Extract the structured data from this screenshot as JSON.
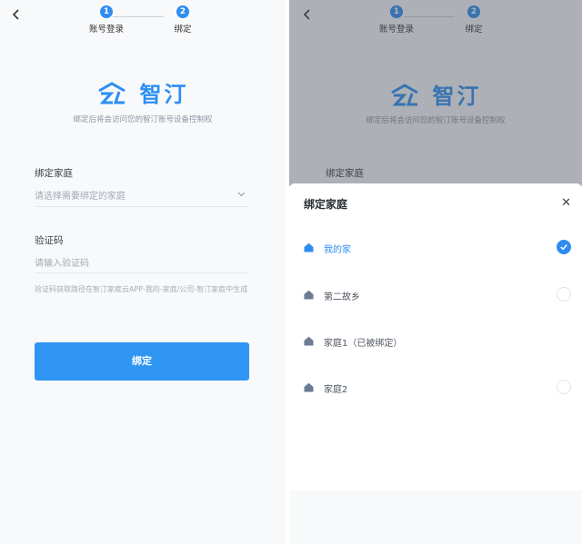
{
  "left_screen": {
    "steps": [
      {
        "number": "1",
        "label": "账号登录"
      },
      {
        "number": "2",
        "label": "绑定"
      }
    ],
    "logo_text": "智汀",
    "subtitle": "绑定后将会访问您的智汀账号设备控制权",
    "bind_home": {
      "label": "绑定家庭",
      "placeholder": "请选择需要绑定的家庭"
    },
    "verify_code": {
      "label": "验证码",
      "placeholder": "请输入验证码"
    },
    "hint": "验证码获取路径在智汀家庭云APP-我的-家庭/公司-智汀家庭中生成",
    "submit_label": "绑定"
  },
  "right_screen": {
    "steps": [
      {
        "number": "1",
        "label": "账号登录"
      },
      {
        "number": "2",
        "label": "绑定"
      }
    ],
    "logo_text": "智汀",
    "subtitle": "绑定后将会访问您的智汀账号设备控制权",
    "bind_home_label": "绑定家庭",
    "sheet": {
      "title": "绑定家庭",
      "options": [
        {
          "label": "我的家",
          "selected": true
        },
        {
          "label": "第二故乡",
          "selected": false
        },
        {
          "label": "家庭1（已被绑定）",
          "selected": false
        },
        {
          "label": "家庭2",
          "selected": false
        }
      ]
    }
  },
  "colors": {
    "accent": "#2f8df2",
    "button": "#2f95f2",
    "overlay": "rgba(70,76,86,0.42)"
  },
  "icons": {
    "back": "chevron-left-icon",
    "close": "close-icon",
    "home": "house-icon",
    "check": "check-icon",
    "dropdown": "chevron-down-icon"
  }
}
